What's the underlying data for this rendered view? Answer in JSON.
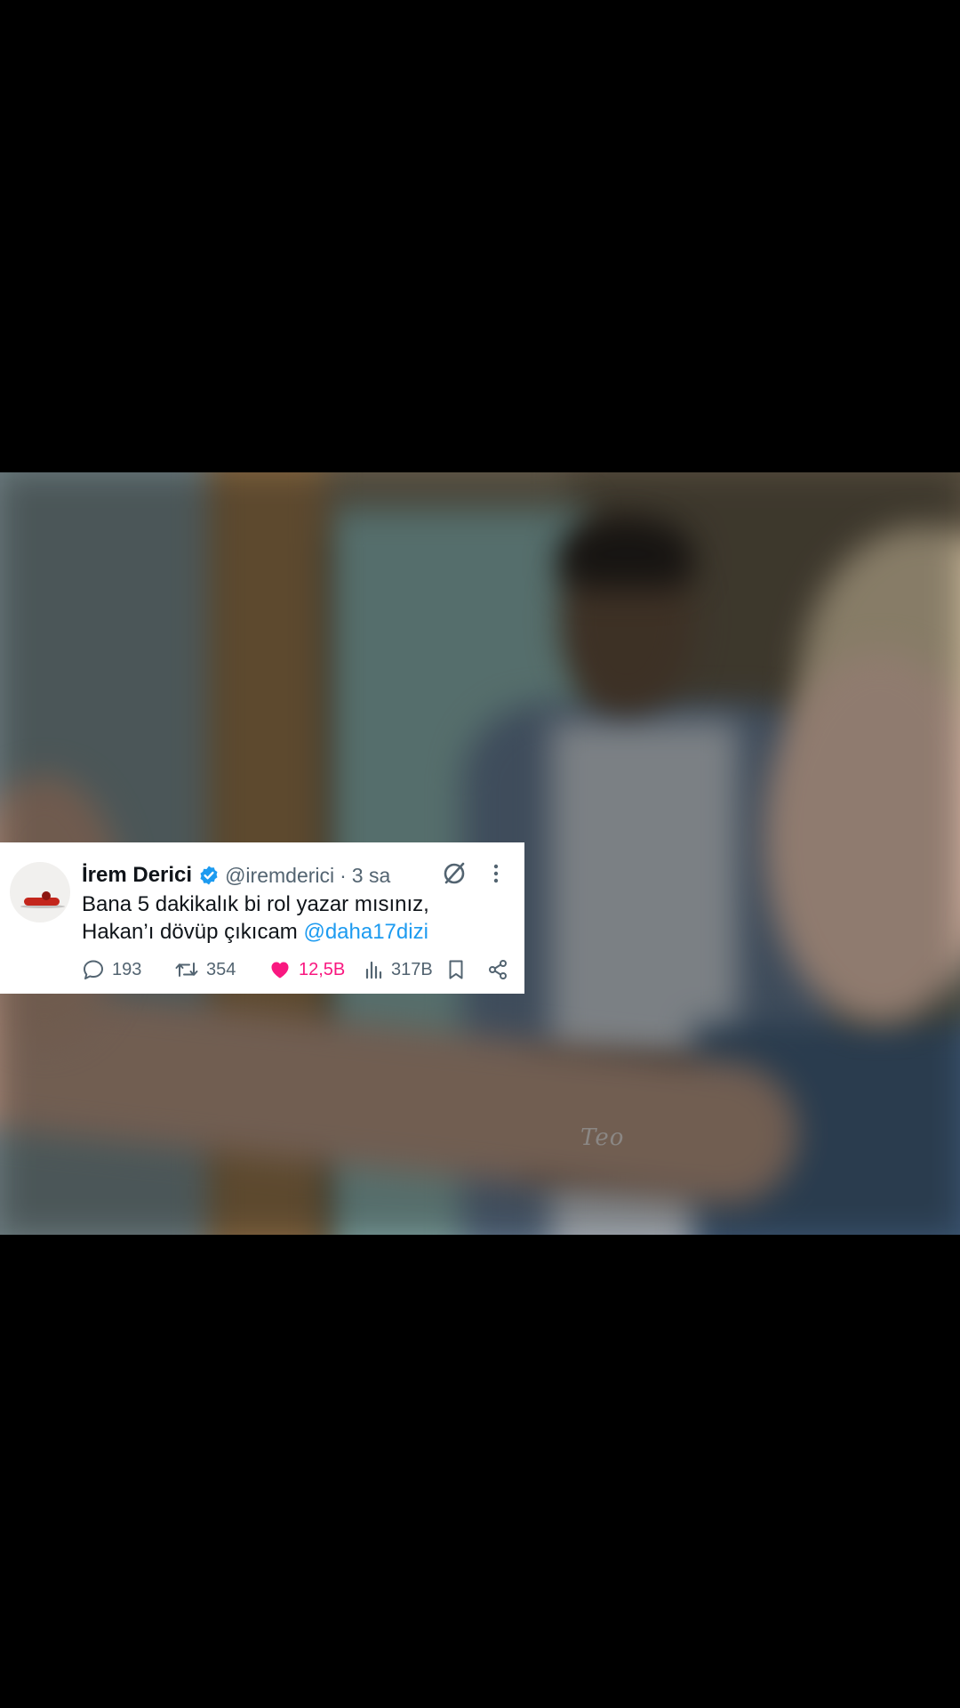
{
  "tweet": {
    "display_name": "İrem Derici",
    "handle": "@iremderici",
    "separator": "·",
    "time": "3 sa",
    "text_line1": "Bana 5 dakikalık bi rol yazar mısınız,",
    "text_line2_prefix": "Hakan’ı dövüp çıkıcam ",
    "mention": "@daha17dizi",
    "verified": true,
    "actions": {
      "replies": "193",
      "retweets": "354",
      "likes": "12,5B",
      "views": "317B"
    },
    "colors": {
      "text": "#0f1419",
      "secondary": "#536471",
      "mention": "#1d9bf0",
      "like": "#f91880",
      "verified": "#1d9bf0"
    },
    "icons": [
      "verified-icon",
      "grok-icon",
      "more-icon",
      "reply-icon",
      "retweet-icon",
      "like-icon",
      "views-icon",
      "bookmark-icon",
      "share-icon"
    ]
  },
  "video": {
    "watermark": "Teo"
  }
}
